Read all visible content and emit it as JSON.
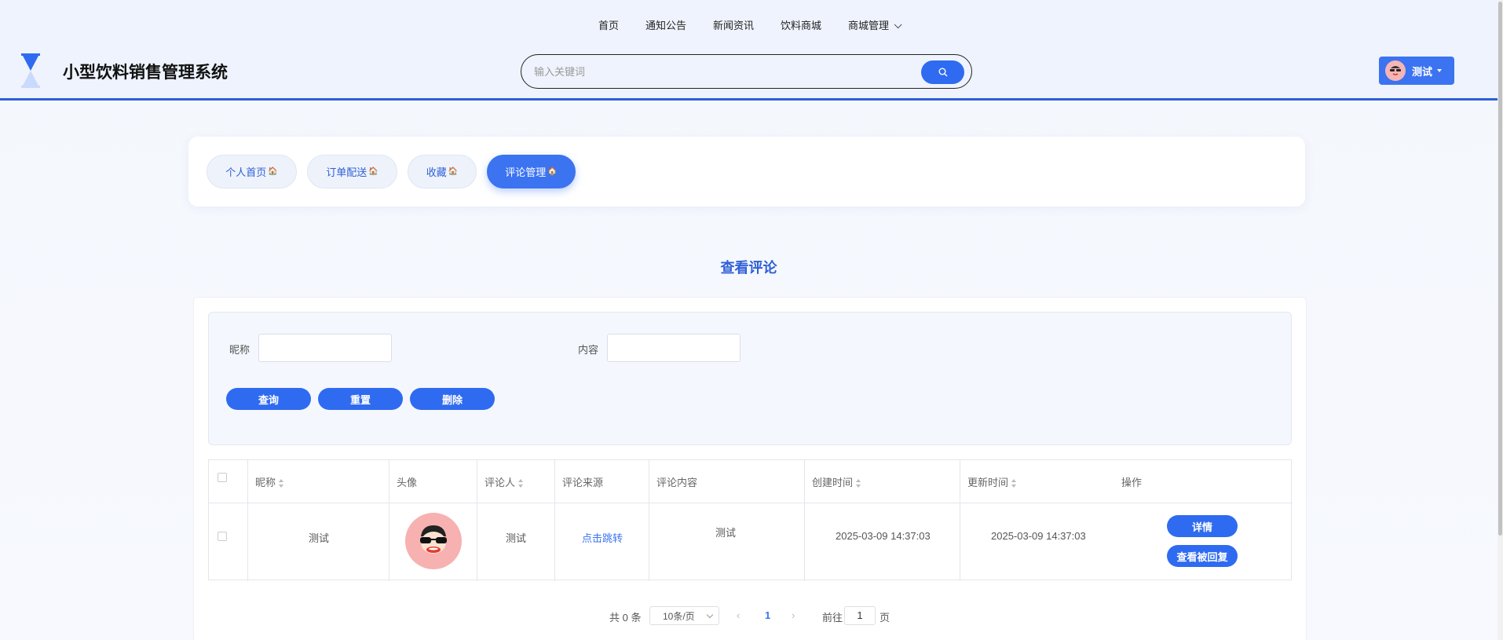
{
  "nav": {
    "items": [
      "首页",
      "通知公告",
      "新闻资讯",
      "饮料商城"
    ],
    "dropdown": "商城管理"
  },
  "site": {
    "title": "小型饮料销售管理系统"
  },
  "search": {
    "placeholder": "输入关键词",
    "value": ""
  },
  "user": {
    "name": "测试"
  },
  "tabs": [
    "个人首页",
    "订单配送",
    "收藏",
    "评论管理"
  ],
  "active_tab": "评论管理",
  "section_title": "查看评论",
  "filters": {
    "nickname_label": "昵称",
    "content_label": "内容",
    "query_label": "查询",
    "reset_label": "重置",
    "delete_label": "删除"
  },
  "table": {
    "headers": [
      "昵称",
      "头像",
      "评论人",
      "评论来源",
      "评论内容",
      "创建时间",
      "更新时间",
      "操作"
    ],
    "rows": [
      {
        "nickname": "测试",
        "commenter": "测试",
        "source": "点击跳转",
        "content": "测试",
        "created": "2025-03-09 14:37:03",
        "updated": "2025-03-09 14:37:03",
        "detail_label": "详情",
        "reply_label": "查看被回复"
      }
    ]
  },
  "pagination": {
    "total": "共 0 条",
    "page_size": "10条/页",
    "current_page": "1",
    "goto_prefix": "前往",
    "goto_value": "1",
    "goto_suffix": "页"
  },
  "colors": {
    "accent": "#2f6bf0",
    "header_bg": "#eef3fd",
    "title_blue": "#2f5fd6"
  }
}
